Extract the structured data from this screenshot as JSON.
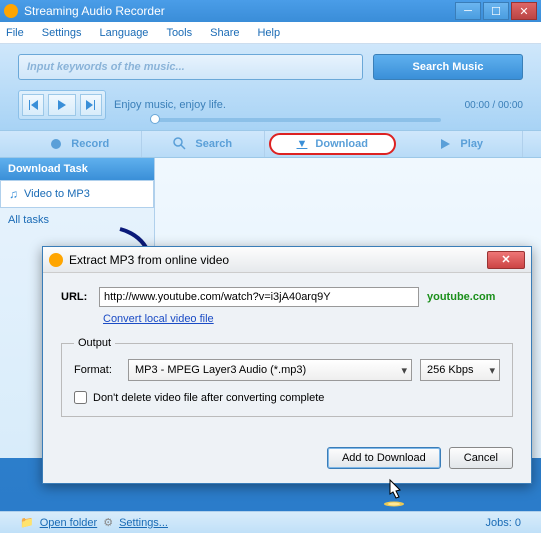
{
  "window": {
    "title": "Streaming Audio Recorder"
  },
  "menu": {
    "file": "File",
    "settings": "Settings",
    "language": "Language",
    "tools": "Tools",
    "share": "Share",
    "help": "Help"
  },
  "search": {
    "placeholder": "Input keywords of the music...",
    "button": "Search Music"
  },
  "player": {
    "text": "Enjoy music, enjoy life.",
    "time": "00:00 / 00:00"
  },
  "tabs": {
    "record": "Record",
    "search": "Search",
    "download": "Download",
    "play": "Play"
  },
  "sidebar": {
    "header": "Download Task",
    "item1": "Video to MP3",
    "item2": "All tasks"
  },
  "footer": {
    "open": "Open folder",
    "settings": "Settings...",
    "jobs": "Jobs: 0"
  },
  "dialog": {
    "title": "Extract MP3 from online video",
    "url_label": "URL:",
    "url_value": "http://www.youtube.com/watch?v=i3jA40arq9Y",
    "site": "youtube.com",
    "convert": "Convert local video file",
    "output": "Output",
    "format_label": "Format:",
    "format_value": "MP3 - MPEG Layer3 Audio (*.mp3)",
    "bitrate": "256 Kbps",
    "checkbox": "Don't delete video file after converting complete",
    "add": "Add to Download",
    "cancel": "Cancel"
  }
}
